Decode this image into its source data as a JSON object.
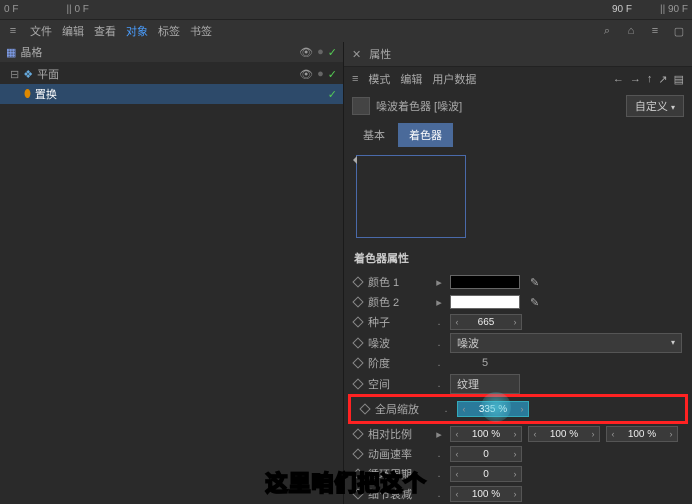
{
  "timeline": {
    "left_frame": "0 F",
    "left_frame2": "0 F",
    "right_frame": "90 F",
    "right_frame2": "90 F"
  },
  "menu": {
    "file": "文件",
    "edit": "编辑",
    "view": "查看",
    "object": "对象",
    "tag": "标签",
    "bookmark": "书签"
  },
  "tree": {
    "root": "晶格",
    "item1": "平面",
    "item2": "置换"
  },
  "panel": {
    "title": "属性",
    "mode": "模式",
    "edit": "编辑",
    "userdata": "用户数据",
    "object_name": "噪波着色器 [噪波]",
    "preset": "自定义",
    "tab_basic": "基本",
    "tab_shader": "着色器"
  },
  "props": {
    "section": "着色器属性",
    "color1": "颜色 1",
    "color2": "颜色 2",
    "seed": "种子",
    "seed_val": "665",
    "noise": "噪波",
    "noise_val": "噪波",
    "octaves": "阶度",
    "octaves_val": "5",
    "space": "空间",
    "space_val": "纹理",
    "global_scale": "全局缩放",
    "global_scale_val": "335 %",
    "rel_scale": "相对比例",
    "rel_scale_vals": [
      "100 %",
      "100 %",
      "100 %"
    ],
    "anim_speed": "动画速率",
    "anim_speed_val": "0",
    "loop": "循环周期",
    "loop_val": "0",
    "detail": "细节衰减",
    "detail_val": "100 %"
  },
  "caption": "这里咱们把这个"
}
